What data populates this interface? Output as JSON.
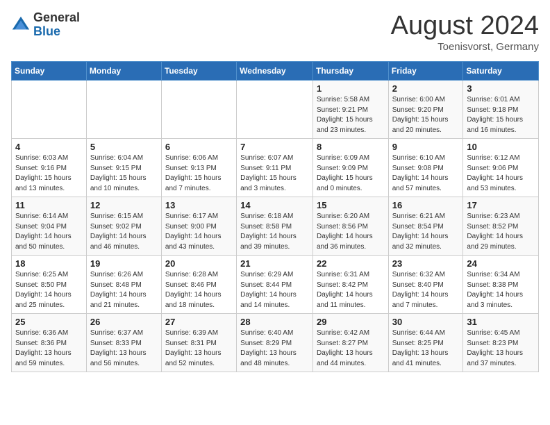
{
  "logo": {
    "general": "General",
    "blue": "Blue"
  },
  "title": "August 2024",
  "subtitle": "Toenisvorst, Germany",
  "weekdays": [
    "Sunday",
    "Monday",
    "Tuesday",
    "Wednesday",
    "Thursday",
    "Friday",
    "Saturday"
  ],
  "weeks": [
    [
      {
        "day": "",
        "info": ""
      },
      {
        "day": "",
        "info": ""
      },
      {
        "day": "",
        "info": ""
      },
      {
        "day": "",
        "info": ""
      },
      {
        "day": "1",
        "info": "Sunrise: 5:58 AM\nSunset: 9:21 PM\nDaylight: 15 hours\nand 23 minutes."
      },
      {
        "day": "2",
        "info": "Sunrise: 6:00 AM\nSunset: 9:20 PM\nDaylight: 15 hours\nand 20 minutes."
      },
      {
        "day": "3",
        "info": "Sunrise: 6:01 AM\nSunset: 9:18 PM\nDaylight: 15 hours\nand 16 minutes."
      }
    ],
    [
      {
        "day": "4",
        "info": "Sunrise: 6:03 AM\nSunset: 9:16 PM\nDaylight: 15 hours\nand 13 minutes."
      },
      {
        "day": "5",
        "info": "Sunrise: 6:04 AM\nSunset: 9:15 PM\nDaylight: 15 hours\nand 10 minutes."
      },
      {
        "day": "6",
        "info": "Sunrise: 6:06 AM\nSunset: 9:13 PM\nDaylight: 15 hours\nand 7 minutes."
      },
      {
        "day": "7",
        "info": "Sunrise: 6:07 AM\nSunset: 9:11 PM\nDaylight: 15 hours\nand 3 minutes."
      },
      {
        "day": "8",
        "info": "Sunrise: 6:09 AM\nSunset: 9:09 PM\nDaylight: 15 hours\nand 0 minutes."
      },
      {
        "day": "9",
        "info": "Sunrise: 6:10 AM\nSunset: 9:08 PM\nDaylight: 14 hours\nand 57 minutes."
      },
      {
        "day": "10",
        "info": "Sunrise: 6:12 AM\nSunset: 9:06 PM\nDaylight: 14 hours\nand 53 minutes."
      }
    ],
    [
      {
        "day": "11",
        "info": "Sunrise: 6:14 AM\nSunset: 9:04 PM\nDaylight: 14 hours\nand 50 minutes."
      },
      {
        "day": "12",
        "info": "Sunrise: 6:15 AM\nSunset: 9:02 PM\nDaylight: 14 hours\nand 46 minutes."
      },
      {
        "day": "13",
        "info": "Sunrise: 6:17 AM\nSunset: 9:00 PM\nDaylight: 14 hours\nand 43 minutes."
      },
      {
        "day": "14",
        "info": "Sunrise: 6:18 AM\nSunset: 8:58 PM\nDaylight: 14 hours\nand 39 minutes."
      },
      {
        "day": "15",
        "info": "Sunrise: 6:20 AM\nSunset: 8:56 PM\nDaylight: 14 hours\nand 36 minutes."
      },
      {
        "day": "16",
        "info": "Sunrise: 6:21 AM\nSunset: 8:54 PM\nDaylight: 14 hours\nand 32 minutes."
      },
      {
        "day": "17",
        "info": "Sunrise: 6:23 AM\nSunset: 8:52 PM\nDaylight: 14 hours\nand 29 minutes."
      }
    ],
    [
      {
        "day": "18",
        "info": "Sunrise: 6:25 AM\nSunset: 8:50 PM\nDaylight: 14 hours\nand 25 minutes."
      },
      {
        "day": "19",
        "info": "Sunrise: 6:26 AM\nSunset: 8:48 PM\nDaylight: 14 hours\nand 21 minutes."
      },
      {
        "day": "20",
        "info": "Sunrise: 6:28 AM\nSunset: 8:46 PM\nDaylight: 14 hours\nand 18 minutes."
      },
      {
        "day": "21",
        "info": "Sunrise: 6:29 AM\nSunset: 8:44 PM\nDaylight: 14 hours\nand 14 minutes."
      },
      {
        "day": "22",
        "info": "Sunrise: 6:31 AM\nSunset: 8:42 PM\nDaylight: 14 hours\nand 11 minutes."
      },
      {
        "day": "23",
        "info": "Sunrise: 6:32 AM\nSunset: 8:40 PM\nDaylight: 14 hours\nand 7 minutes."
      },
      {
        "day": "24",
        "info": "Sunrise: 6:34 AM\nSunset: 8:38 PM\nDaylight: 14 hours\nand 3 minutes."
      }
    ],
    [
      {
        "day": "25",
        "info": "Sunrise: 6:36 AM\nSunset: 8:36 PM\nDaylight: 13 hours\nand 59 minutes."
      },
      {
        "day": "26",
        "info": "Sunrise: 6:37 AM\nSunset: 8:33 PM\nDaylight: 13 hours\nand 56 minutes."
      },
      {
        "day": "27",
        "info": "Sunrise: 6:39 AM\nSunset: 8:31 PM\nDaylight: 13 hours\nand 52 minutes."
      },
      {
        "day": "28",
        "info": "Sunrise: 6:40 AM\nSunset: 8:29 PM\nDaylight: 13 hours\nand 48 minutes."
      },
      {
        "day": "29",
        "info": "Sunrise: 6:42 AM\nSunset: 8:27 PM\nDaylight: 13 hours\nand 44 minutes."
      },
      {
        "day": "30",
        "info": "Sunrise: 6:44 AM\nSunset: 8:25 PM\nDaylight: 13 hours\nand 41 minutes."
      },
      {
        "day": "31",
        "info": "Sunrise: 6:45 AM\nSunset: 8:23 PM\nDaylight: 13 hours\nand 37 minutes."
      }
    ]
  ]
}
